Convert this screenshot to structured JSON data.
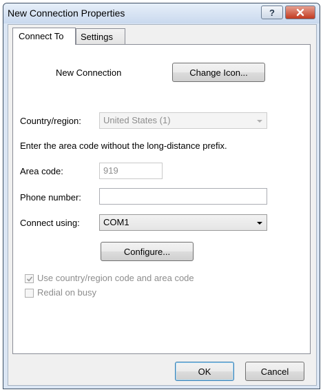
{
  "window": {
    "title": "New Connection Properties",
    "help_label": "?",
    "close_label": "✕"
  },
  "tabs": [
    {
      "label": "Connect To",
      "active": true
    },
    {
      "label": "Settings",
      "active": false
    }
  ],
  "connect_to": {
    "connection_name": "New Connection",
    "change_icon_label": "Change Icon...",
    "country_label": "Country/region:",
    "country_value": "United States (1)",
    "area_code_instruction": "Enter the area code without the long-distance prefix.",
    "area_code_label": "Area code:",
    "area_code_value": "919",
    "phone_label": "Phone number:",
    "phone_value": "",
    "connect_using_label": "Connect using:",
    "connect_using_value": "COM1",
    "configure_label": "Configure...",
    "use_country_code_label": "Use country/region code and area code",
    "use_country_code_checked": true,
    "redial_label": "Redial on busy",
    "redial_checked": false
  },
  "footer": {
    "ok_label": "OK",
    "cancel_label": "Cancel"
  },
  "colors": {
    "window_frame": "#dbe6f4",
    "close_button": "#c23a20",
    "default_button_border": "#3c7fb1",
    "disabled_text": "#8d8d8d"
  }
}
